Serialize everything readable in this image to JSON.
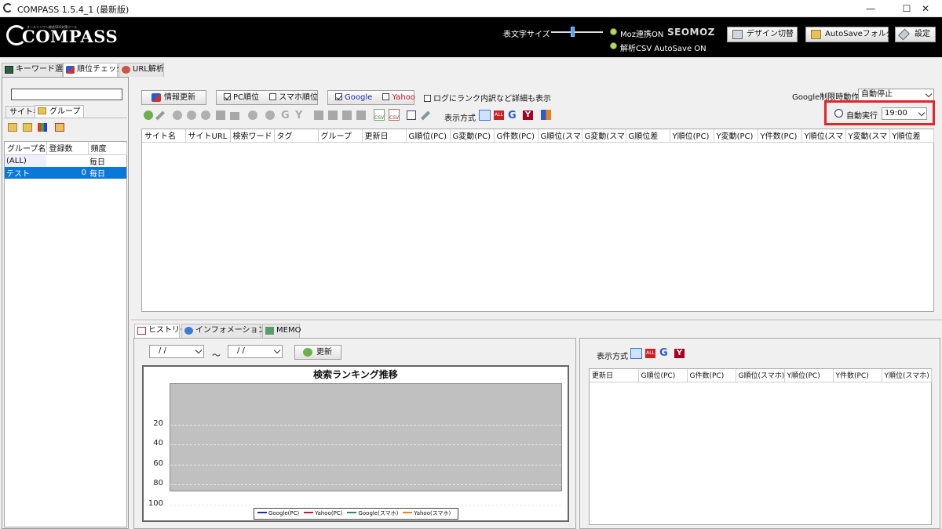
{
  "titlebar": {
    "title": "COMPASS 1.5.4_1 (最新版)",
    "minimize": "—",
    "maximize": "☐",
    "close": "✕"
  },
  "header": {
    "logo": "COMPASS",
    "logo_sub": "オールインワン総合SEO対策ツール",
    "font_size_label": "表文字サイズ",
    "moz_status": "Moz連携ON",
    "moz_logo": "SEOMOZ",
    "csv_status": "解析CSV AutoSave ON",
    "design_button": "デザイン切替",
    "autosave_button": "AutoSaveフォルダ",
    "settings_button": "設定"
  },
  "main_tabs": [
    "キーワード選定",
    "順位チェック",
    "URL解析"
  ],
  "left_panel": {
    "tabs": [
      "サイト名",
      "グループ"
    ],
    "columns": [
      "グループ名",
      "登録数",
      "頻度"
    ],
    "rows": [
      {
        "name": "(ALL)",
        "count": "",
        "freq": "毎日"
      },
      {
        "name": "テスト",
        "count": "0",
        "freq": "毎日"
      }
    ]
  },
  "toolbar": {
    "update_button": "情報更新",
    "pc_rank": "PC順位",
    "sp_rank": "スマホ順位",
    "google": "Google",
    "yahoo": "Yahoo",
    "log_detail": "ログにランク内訳など詳細も表示",
    "google_limit_label": "Google制限時動作",
    "google_limit_value": "自動停止",
    "display_mode": "表示方式",
    "auto_run": "自動実行",
    "auto_time": "19:00",
    "csv_label": "CSV"
  },
  "main_table_columns": [
    "サイト名",
    "サイトURL",
    "検索ワード",
    "タグ",
    "グループ",
    "更新日",
    "G順位(PC)",
    "G変動(PC)",
    "G件数(PC)",
    "G順位(スマ",
    "G変動(スマ",
    "G順位差",
    "Y順位(PC)",
    "Y変動(PC)",
    "Y件数(PC)",
    "Y順位(スマ",
    "Y変動(スマ",
    "Y順位差"
  ],
  "bottom_tabs": [
    "ヒストリー",
    "インフォメーション/ログ",
    "MEMO"
  ],
  "history": {
    "date_from": "/ /",
    "date_to": "/ /",
    "tilde": "～",
    "update_button": "更新"
  },
  "chart_data": {
    "type": "line",
    "title": "検索ランキング推移",
    "y_ticks": [
      "20",
      "40",
      "60",
      "80",
      "100"
    ],
    "ylim": [
      100,
      0
    ],
    "y_reversed": true,
    "grid": true,
    "legend_placement": "bottom-center",
    "series": [
      {
        "name": "Google(PC)",
        "color": "#1a2aa8",
        "values": []
      },
      {
        "name": "Yahoo(PC)",
        "color": "#c21c2c",
        "values": []
      },
      {
        "name": "Google(スマホ)",
        "color": "#2a8a50",
        "values": []
      },
      {
        "name": "Yahoo(スマホ)",
        "color": "#e8801c",
        "values": []
      }
    ]
  },
  "right_panel": {
    "display_mode": "表示方式",
    "columns": [
      "更新日",
      "G順位(PC)",
      "G件数(PC)",
      "G順位(スマホ)",
      "Y順位(PC)",
      "Y件数(PC)",
      "Y順位(スマホ)"
    ]
  }
}
